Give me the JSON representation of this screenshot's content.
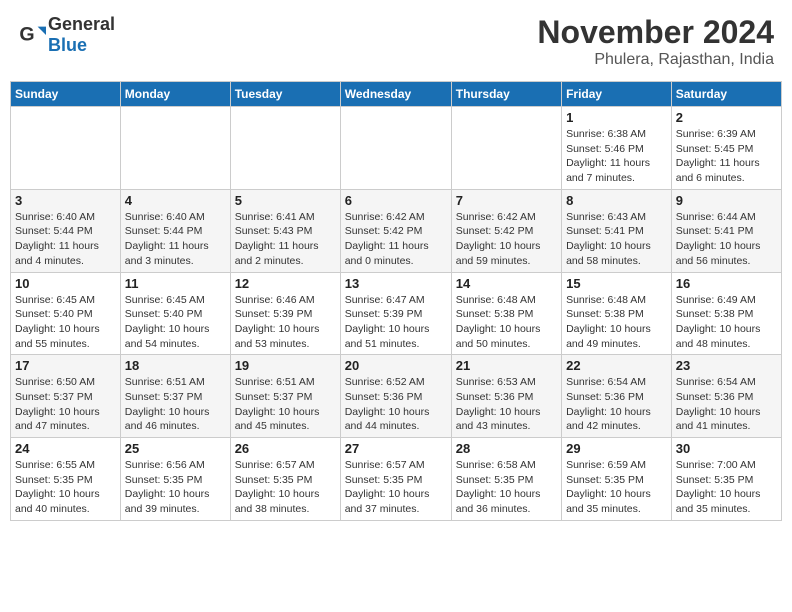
{
  "header": {
    "logo_general": "General",
    "logo_blue": "Blue",
    "month_title": "November 2024",
    "location": "Phulera, Rajasthan, India"
  },
  "weekdays": [
    "Sunday",
    "Monday",
    "Tuesday",
    "Wednesday",
    "Thursday",
    "Friday",
    "Saturday"
  ],
  "weeks": [
    [
      {
        "day": "",
        "info": ""
      },
      {
        "day": "",
        "info": ""
      },
      {
        "day": "",
        "info": ""
      },
      {
        "day": "",
        "info": ""
      },
      {
        "day": "",
        "info": ""
      },
      {
        "day": "1",
        "info": "Sunrise: 6:38 AM\nSunset: 5:46 PM\nDaylight: 11 hours\nand 7 minutes."
      },
      {
        "day": "2",
        "info": "Sunrise: 6:39 AM\nSunset: 5:45 PM\nDaylight: 11 hours\nand 6 minutes."
      }
    ],
    [
      {
        "day": "3",
        "info": "Sunrise: 6:40 AM\nSunset: 5:44 PM\nDaylight: 11 hours\nand 4 minutes."
      },
      {
        "day": "4",
        "info": "Sunrise: 6:40 AM\nSunset: 5:44 PM\nDaylight: 11 hours\nand 3 minutes."
      },
      {
        "day": "5",
        "info": "Sunrise: 6:41 AM\nSunset: 5:43 PM\nDaylight: 11 hours\nand 2 minutes."
      },
      {
        "day": "6",
        "info": "Sunrise: 6:42 AM\nSunset: 5:42 PM\nDaylight: 11 hours\nand 0 minutes."
      },
      {
        "day": "7",
        "info": "Sunrise: 6:42 AM\nSunset: 5:42 PM\nDaylight: 10 hours\nand 59 minutes."
      },
      {
        "day": "8",
        "info": "Sunrise: 6:43 AM\nSunset: 5:41 PM\nDaylight: 10 hours\nand 58 minutes."
      },
      {
        "day": "9",
        "info": "Sunrise: 6:44 AM\nSunset: 5:41 PM\nDaylight: 10 hours\nand 56 minutes."
      }
    ],
    [
      {
        "day": "10",
        "info": "Sunrise: 6:45 AM\nSunset: 5:40 PM\nDaylight: 10 hours\nand 55 minutes."
      },
      {
        "day": "11",
        "info": "Sunrise: 6:45 AM\nSunset: 5:40 PM\nDaylight: 10 hours\nand 54 minutes."
      },
      {
        "day": "12",
        "info": "Sunrise: 6:46 AM\nSunset: 5:39 PM\nDaylight: 10 hours\nand 53 minutes."
      },
      {
        "day": "13",
        "info": "Sunrise: 6:47 AM\nSunset: 5:39 PM\nDaylight: 10 hours\nand 51 minutes."
      },
      {
        "day": "14",
        "info": "Sunrise: 6:48 AM\nSunset: 5:38 PM\nDaylight: 10 hours\nand 50 minutes."
      },
      {
        "day": "15",
        "info": "Sunrise: 6:48 AM\nSunset: 5:38 PM\nDaylight: 10 hours\nand 49 minutes."
      },
      {
        "day": "16",
        "info": "Sunrise: 6:49 AM\nSunset: 5:38 PM\nDaylight: 10 hours\nand 48 minutes."
      }
    ],
    [
      {
        "day": "17",
        "info": "Sunrise: 6:50 AM\nSunset: 5:37 PM\nDaylight: 10 hours\nand 47 minutes."
      },
      {
        "day": "18",
        "info": "Sunrise: 6:51 AM\nSunset: 5:37 PM\nDaylight: 10 hours\nand 46 minutes."
      },
      {
        "day": "19",
        "info": "Sunrise: 6:51 AM\nSunset: 5:37 PM\nDaylight: 10 hours\nand 45 minutes."
      },
      {
        "day": "20",
        "info": "Sunrise: 6:52 AM\nSunset: 5:36 PM\nDaylight: 10 hours\nand 44 minutes."
      },
      {
        "day": "21",
        "info": "Sunrise: 6:53 AM\nSunset: 5:36 PM\nDaylight: 10 hours\nand 43 minutes."
      },
      {
        "day": "22",
        "info": "Sunrise: 6:54 AM\nSunset: 5:36 PM\nDaylight: 10 hours\nand 42 minutes."
      },
      {
        "day": "23",
        "info": "Sunrise: 6:54 AM\nSunset: 5:36 PM\nDaylight: 10 hours\nand 41 minutes."
      }
    ],
    [
      {
        "day": "24",
        "info": "Sunrise: 6:55 AM\nSunset: 5:35 PM\nDaylight: 10 hours\nand 40 minutes."
      },
      {
        "day": "25",
        "info": "Sunrise: 6:56 AM\nSunset: 5:35 PM\nDaylight: 10 hours\nand 39 minutes."
      },
      {
        "day": "26",
        "info": "Sunrise: 6:57 AM\nSunset: 5:35 PM\nDaylight: 10 hours\nand 38 minutes."
      },
      {
        "day": "27",
        "info": "Sunrise: 6:57 AM\nSunset: 5:35 PM\nDaylight: 10 hours\nand 37 minutes."
      },
      {
        "day": "28",
        "info": "Sunrise: 6:58 AM\nSunset: 5:35 PM\nDaylight: 10 hours\nand 36 minutes."
      },
      {
        "day": "29",
        "info": "Sunrise: 6:59 AM\nSunset: 5:35 PM\nDaylight: 10 hours\nand 35 minutes."
      },
      {
        "day": "30",
        "info": "Sunrise: 7:00 AM\nSunset: 5:35 PM\nDaylight: 10 hours\nand 35 minutes."
      }
    ]
  ]
}
